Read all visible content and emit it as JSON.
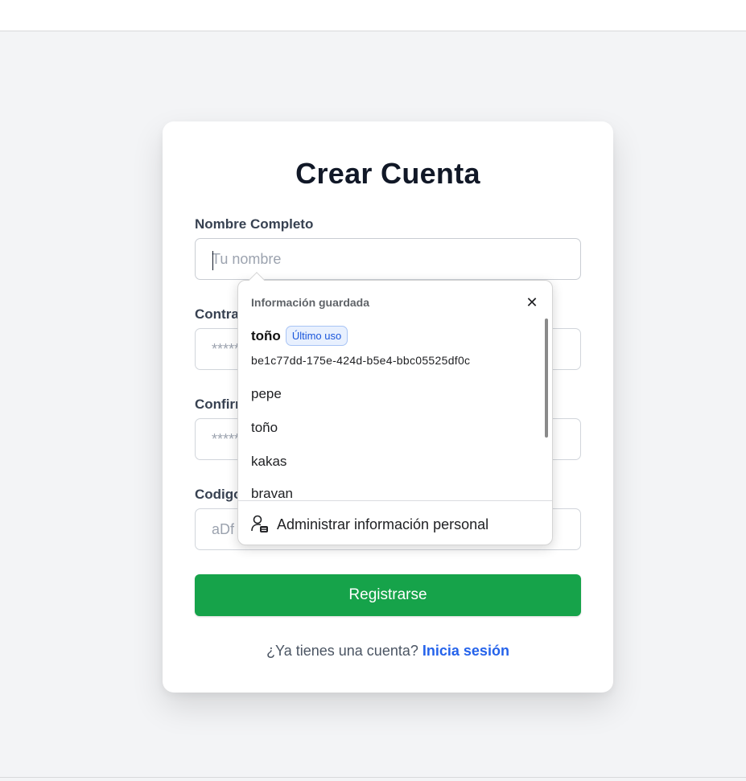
{
  "form": {
    "title": "Crear Cuenta",
    "name_label": "Nombre Completo",
    "name_placeholder": "Tu nombre",
    "password_label": "Contra",
    "password_placeholder": "********",
    "confirm_label": "Confirm",
    "confirm_placeholder": "********",
    "code_label": "Codigo",
    "code_placeholder": "aDf",
    "submit_label": "Registrarse",
    "login_prompt": "¿Ya tienes una cuenta?",
    "login_link": "Inicia sesión"
  },
  "autofill": {
    "header": "Información guardada",
    "close_icon": "close-icon",
    "primary": {
      "name": "toño",
      "badge": "Último uso",
      "id": "be1c77dd-175e-424d-b5e4-bbc05525df0c"
    },
    "items": [
      "pepe",
      "toño",
      "kakas",
      "bravan"
    ],
    "manage_label": "Administrar información personal",
    "manage_icon": "person-card-icon"
  },
  "colors": {
    "primary_button": "#16a34a",
    "link": "#2563eb",
    "badge_bg": "#e8f0fe",
    "page_bg": "#f3f4f6"
  }
}
